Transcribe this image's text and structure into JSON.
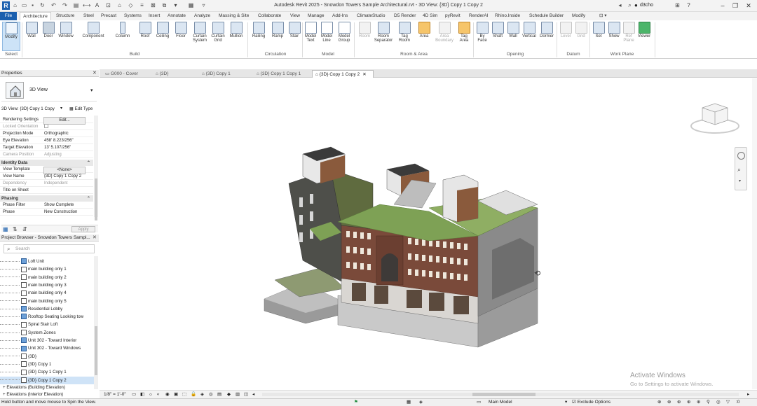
{
  "titlebar": {
    "doc_title": "Autodesk Revit 2025 - Snowdon Towers Sample Architectural.rvt - 3D View: {3D} Copy 1 Copy 2",
    "user": "d3cho"
  },
  "ribbon_tabs": [
    "File",
    "Architecture",
    "Structure",
    "Steel",
    "Precast",
    "Systems",
    "Insert",
    "Annotate",
    "Analyze",
    "Massing & Site",
    "Collaborate",
    "View",
    "Manage",
    "Add-Ins",
    "ClimateStudio",
    "D5 Render",
    "4D Sim",
    "pyRevit",
    "RenderAI",
    "Rhino.Inside",
    "Schedule Builder",
    "Modify"
  ],
  "ribbon": {
    "tools": [
      {
        "label": "Modify",
        "icon": "modify-cursor-icon"
      },
      {
        "label": "Wall",
        "icon": "wall-icon"
      },
      {
        "label": "Door",
        "icon": "door-icon"
      },
      {
        "label": "Window",
        "icon": "window-icon"
      },
      {
        "label": "Component",
        "icon": "component-icon"
      },
      {
        "label": "Column",
        "icon": "column-icon"
      },
      {
        "label": "Roof",
        "icon": "roof-icon"
      },
      {
        "label": "Ceiling",
        "icon": "ceiling-icon"
      },
      {
        "label": "Floor",
        "icon": "floor-icon"
      },
      {
        "label": "Curtain System",
        "icon": "curtain-system-icon"
      },
      {
        "label": "Curtain Grid",
        "icon": "curtain-grid-icon"
      },
      {
        "label": "Mullion",
        "icon": "mullion-icon"
      },
      {
        "label": "Railing",
        "icon": "railing-icon"
      },
      {
        "label": "Ramp",
        "icon": "ramp-icon"
      },
      {
        "label": "Stair",
        "icon": "stair-icon"
      },
      {
        "label": "Model Text",
        "icon": "model-text-icon"
      },
      {
        "label": "Model Line",
        "icon": "model-line-icon"
      },
      {
        "label": "Model Group",
        "icon": "model-group-icon"
      },
      {
        "label": "Room",
        "icon": "room-icon"
      },
      {
        "label": "Room Separator",
        "icon": "room-separator-icon"
      },
      {
        "label": "Tag Room",
        "icon": "tag-room-icon"
      },
      {
        "label": "Area",
        "icon": "area-icon"
      },
      {
        "label": "Area Boundary",
        "icon": "area-boundary-icon"
      },
      {
        "label": "Tag Area",
        "icon": "tag-area-icon"
      },
      {
        "label": "By Face",
        "icon": "by-face-icon"
      },
      {
        "label": "Shaft",
        "icon": "shaft-icon"
      },
      {
        "label": "Wall",
        "icon": "wall-opening-icon"
      },
      {
        "label": "Vertical",
        "icon": "vertical-opening-icon"
      },
      {
        "label": "Dormer",
        "icon": "dormer-icon"
      },
      {
        "label": "Level",
        "icon": "level-icon"
      },
      {
        "label": "Grid",
        "icon": "grid-icon"
      },
      {
        "label": "Set",
        "icon": "set-workplane-icon"
      },
      {
        "label": "Show",
        "icon": "show-workplane-icon"
      },
      {
        "label": "Ref Plane",
        "icon": "ref-plane-icon"
      },
      {
        "label": "Viewer",
        "icon": "viewer-icon"
      }
    ],
    "panels": [
      "Select",
      "Build",
      "Circulation",
      "Model",
      "Room & Area",
      "Opening",
      "Datum",
      "Work Plane"
    ]
  },
  "properties": {
    "title": "Properties",
    "type_name": "3D View",
    "instance_selector": "3D View: {3D} Copy 1 Copy",
    "edit_type": "Edit Type",
    "rows": [
      {
        "key": "Rendering Settings",
        "value": "Edit..."
      },
      {
        "key": "Locked Orientation",
        "value": ""
      },
      {
        "key": "Projection Mode",
        "value": "Orthographic"
      },
      {
        "key": "Eye Elevation",
        "value": "458' 8.223/256\""
      },
      {
        "key": "Target Elevation",
        "value": "13' 5.107/256\""
      },
      {
        "key": "Camera Position",
        "value": "Adjusting"
      }
    ],
    "identity_section": "Identity Data",
    "identity_rows": [
      {
        "key": "View Template",
        "value": "<None>"
      },
      {
        "key": "View Name",
        "value": "{3D} Copy 1 Copy 2"
      },
      {
        "key": "Dependency",
        "value": "Independent"
      },
      {
        "key": "Title on Sheet",
        "value": ""
      }
    ],
    "phasing_section": "Phasing",
    "phasing_rows": [
      {
        "key": "Phase Filter",
        "value": "Show Complete"
      },
      {
        "key": "Phase",
        "value": "New Construction"
      }
    ],
    "apply": "Apply"
  },
  "project_browser": {
    "title": "Project Browser - Snowdon Towers Sampl...",
    "search_placeholder": "Search",
    "items": [
      {
        "label": "Loft Unit",
        "blue": true
      },
      {
        "label": "main building only 1",
        "blue": false
      },
      {
        "label": "main building only 2",
        "blue": false
      },
      {
        "label": "main building only 3",
        "blue": false
      },
      {
        "label": "main building only 4",
        "blue": false
      },
      {
        "label": "main building only 5",
        "blue": false
      },
      {
        "label": "Residential Lobby",
        "blue": true
      },
      {
        "label": "Rooftop Seating Looking tow",
        "blue": true
      },
      {
        "label": "Spiral Stair Loft",
        "blue": false
      },
      {
        "label": "System Zones",
        "blue": false
      },
      {
        "label": "Unit 302 - Toward Interior",
        "blue": true
      },
      {
        "label": "Unit 302 - Toward Windows",
        "blue": true
      },
      {
        "label": "{3D}",
        "blue": false
      },
      {
        "label": "{3D} Copy 1",
        "blue": false
      },
      {
        "label": "{3D} Copy 1 Copy 1",
        "blue": false
      },
      {
        "label": "{3D} Copy 1 Copy 2",
        "blue": false
      }
    ],
    "groups": [
      "Elevations (Building Elevation)",
      "Elevations (Interior Elevation)"
    ]
  },
  "view_tabs": [
    "G000 - Cover",
    "{3D}",
    "{3D} Copy 1",
    "{3D} Copy 1 Copy 1",
    "{3D} Copy 1 Copy 2"
  ],
  "view_control": {
    "scale": "1/8\" = 1'-0\""
  },
  "status": {
    "hint": "Hold button and move mouse to Spin the View.",
    "model": "Main Model",
    "exclude": "Exclude Options"
  },
  "watermark": {
    "line1": "Activate Windows",
    "line2": "Go to Settings to activate Windows."
  }
}
